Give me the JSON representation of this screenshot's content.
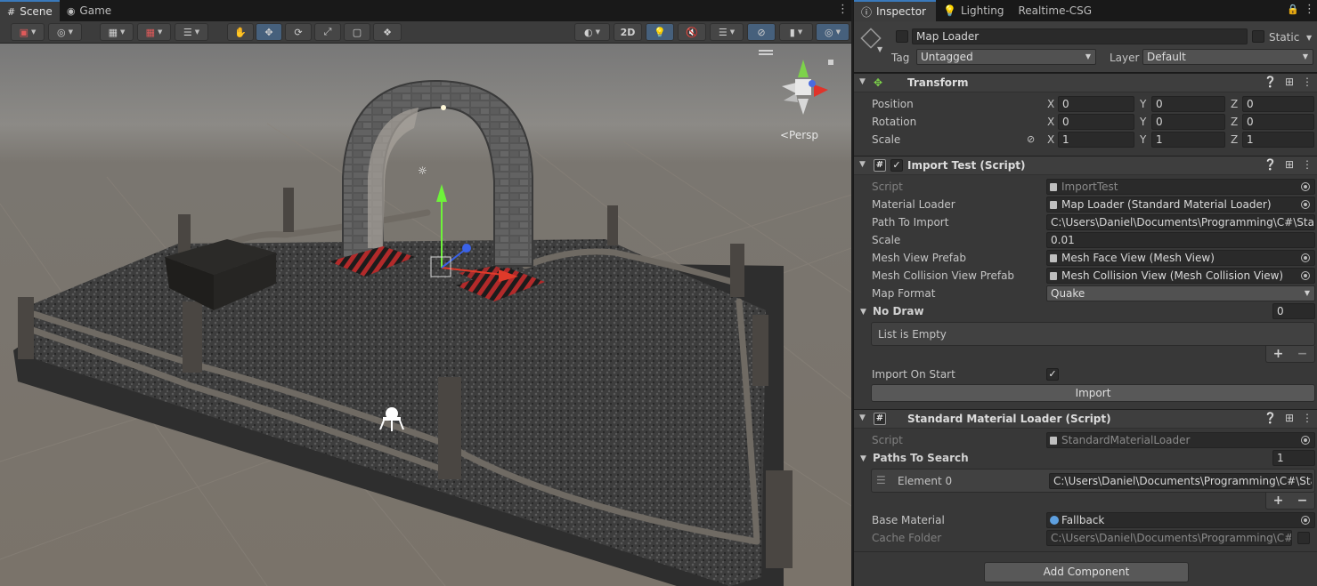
{
  "scene_tabs": {
    "scene": "Scene",
    "game": "Game"
  },
  "toolbar": {
    "btn_2d": "2D"
  },
  "viewport": {
    "persp_label": "<Persp"
  },
  "inspector_tabs": {
    "inspector": "Inspector",
    "lighting": "Lighting",
    "realtime_csg": "Realtime-CSG"
  },
  "object": {
    "name": "Map Loader",
    "static_label": "Static",
    "tag_label": "Tag",
    "tag_value": "Untagged",
    "layer_label": "Layer",
    "layer_value": "Default"
  },
  "transform": {
    "title": "Transform",
    "rows": [
      {
        "label": "Position",
        "x": "0",
        "y": "0",
        "z": "0"
      },
      {
        "label": "Rotation",
        "x": "0",
        "y": "0",
        "z": "0"
      },
      {
        "label": "Scale",
        "x": "1",
        "y": "1",
        "z": "1"
      }
    ],
    "axis_x": "X",
    "axis_y": "Y",
    "axis_z": "Z"
  },
  "import_test": {
    "title": "Import Test (Script)",
    "script_label": "Script",
    "script_value": "ImportTest",
    "material_loader_label": "Material Loader",
    "material_loader_value": "Map Loader (Standard Material Loader)",
    "path_label": "Path To Import",
    "path_value": "C:\\Users\\Daniel\\Documents\\Programming\\C#\\StairCl",
    "scale_label": "Scale",
    "scale_value": "0.01",
    "mesh_view_label": "Mesh View Prefab",
    "mesh_view_value": "Mesh Face View (Mesh View)",
    "mesh_collision_label": "Mesh Collision View Prefab",
    "mesh_collision_value": "Mesh Collision View (Mesh Collision View)",
    "map_format_label": "Map Format",
    "map_format_value": "Quake",
    "no_draw_label": "No Draw",
    "no_draw_count": "0",
    "list_empty": "List is Empty",
    "import_on_start_label": "Import On Start",
    "import_button": "Import"
  },
  "standard_loader": {
    "title": "Standard Material Loader (Script)",
    "script_label": "Script",
    "script_value": "StandardMaterialLoader",
    "paths_label": "Paths To Search",
    "paths_count": "1",
    "element_label": "Element 0",
    "element_value": "C:\\Users\\Daniel\\Documents\\Programming\\C#\\Stair",
    "base_material_label": "Base Material",
    "base_material_value": "Fallback",
    "cache_folder_label": "Cache Folder",
    "cache_folder_value": "C:\\Users\\Daniel\\Documents\\Programming\\C#\\S"
  },
  "add_component": "Add Component",
  "colors": {
    "accent": "#3a79bb",
    "panel": "#383838",
    "field": "#2a2a2a"
  }
}
